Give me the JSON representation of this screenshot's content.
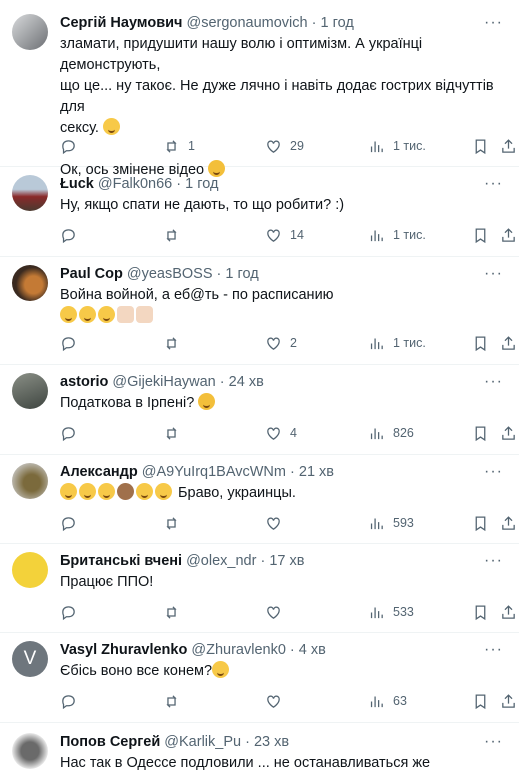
{
  "tweets": [
    {
      "name": "Сергій Наумович",
      "handle": "@sergonaumovich",
      "time": "1 год",
      "lines": [
        "зламати, придушити нашу волю і оптимізм. А українці демонструють,",
        "що це... ну такоє. Не дуже лячно і навіть додає гострих відчуттів для",
        "сексу."
      ],
      "line2": "Ок, ось змінене відео",
      "replies": "",
      "retweets": "1",
      "likes": "29",
      "views": "1 тис."
    },
    {
      "name": "Łuck",
      "handle": "@Falk0n66",
      "time": "1 год",
      "text": "Ну, якщо спати не дають, то що робити? :)",
      "replies": "",
      "retweets": "",
      "likes": "14",
      "views": "1 тис."
    },
    {
      "name": "Paul Cop",
      "handle": "@yeasBOSS",
      "time": "1 год",
      "text": "Война войной, а еб@ть - по расписанию",
      "replies": "",
      "retweets": "",
      "likes": "2",
      "views": "1 тис."
    },
    {
      "name": "astorio",
      "handle": "@GijekiHaywan",
      "time": "24 хв",
      "text": "Податкова в Ірпені?",
      "replies": "",
      "retweets": "",
      "likes": "4",
      "views": "826"
    },
    {
      "name": "Александр",
      "handle": "@A9YuIrq1BAvcWNm",
      "time": "21 хв",
      "text": "Браво, украинцы.",
      "replies": "",
      "retweets": "",
      "likes": "",
      "views": "593"
    },
    {
      "name": "Британські вчені",
      "handle": "@olex_ndr",
      "time": "17 хв",
      "text": "Працює ППО!",
      "replies": "",
      "retweets": "",
      "likes": "",
      "views": "533"
    },
    {
      "name": "Vasyl Zhuravlenko",
      "handle": "@Zhuravlenk0",
      "time": "4 хв",
      "text": "Єбісь воно все конем?",
      "replies": "",
      "retweets": "",
      "likes": "",
      "views": "63",
      "avatar_letter": "V"
    },
    {
      "name": "Попов Сергей",
      "handle": "@Karlik_Pu",
      "time": "23 хв",
      "text": "Нас так в Одессе подловили ... не останавливаться же"
    }
  ],
  "dot": "·",
  "more": "···",
  "colors": {
    "text": "#0f1419",
    "secondary": "#536471",
    "border": "#eff3f4"
  }
}
